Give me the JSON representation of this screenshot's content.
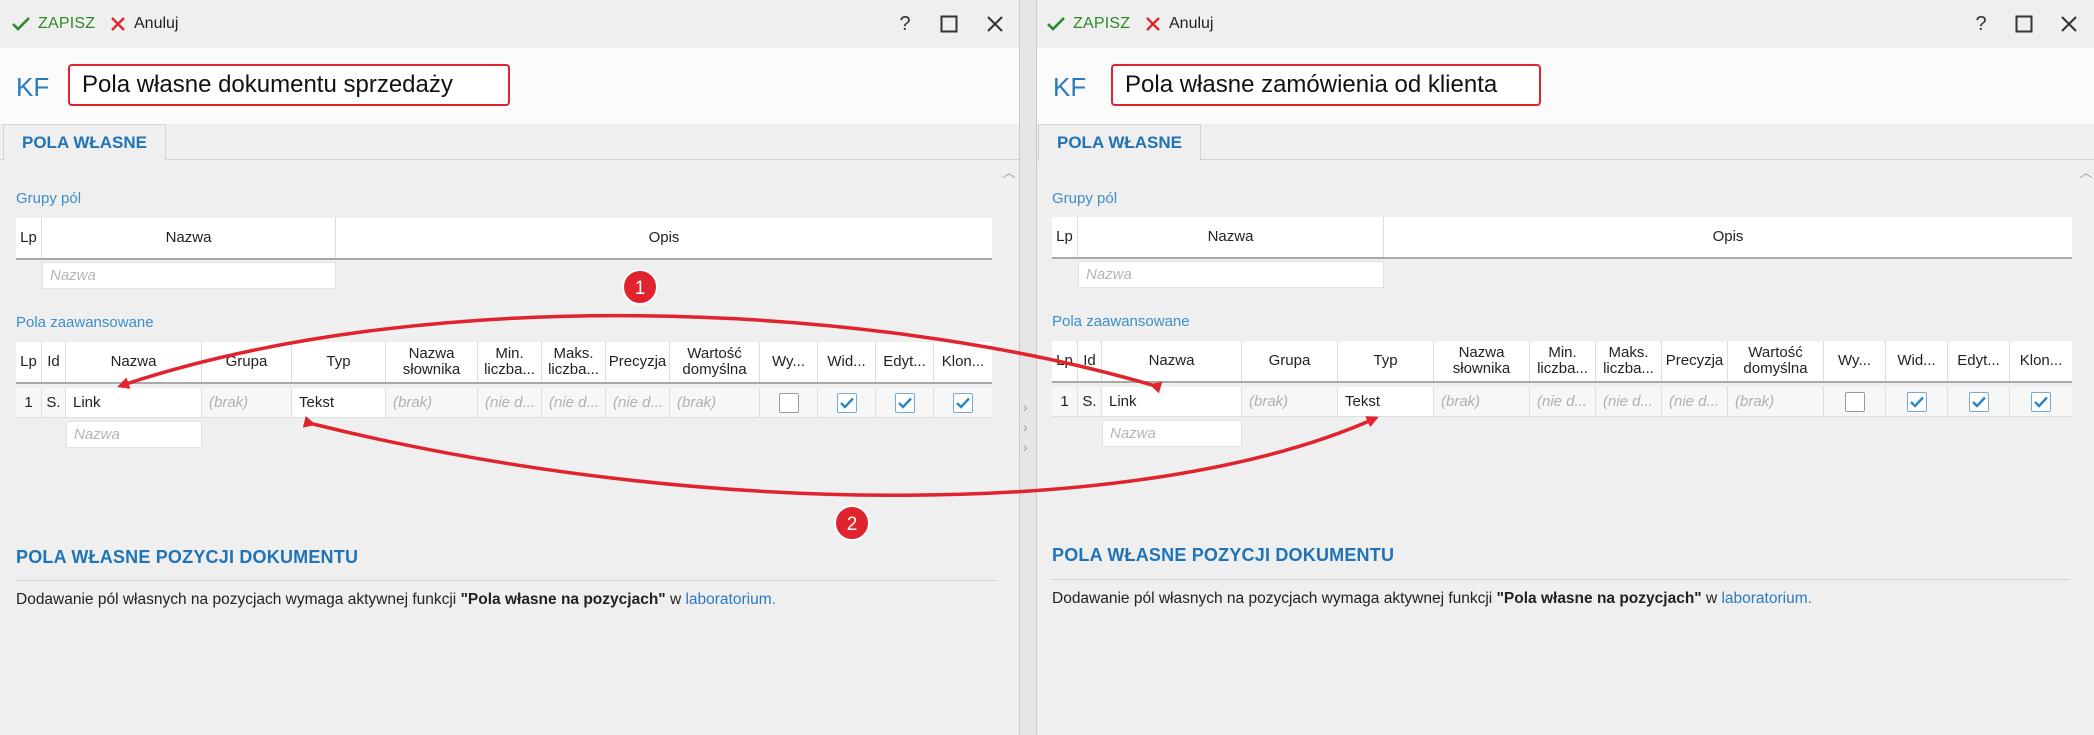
{
  "toolbar": {
    "save_label": "ZAPISZ",
    "cancel_label": "Anuluj",
    "help_label": "?"
  },
  "header": {
    "prefix": "KF"
  },
  "tab_label": "POLA WŁASNE",
  "groups": {
    "label": "Grupy pól",
    "columns": [
      "Lp",
      "Nazwa",
      "Opis"
    ],
    "new_placeholder": "Nazwa"
  },
  "advanced": {
    "label": "Pola zaawansowane",
    "columns": [
      "Lp",
      "Id",
      "Nazwa",
      "Grupa",
      "Typ",
      "Nazwa słownika",
      "Min. liczba...",
      "Maks. liczba...",
      "Precyzja",
      "Wartość domyślna",
      "Wy...",
      "Wid...",
      "Edyt...",
      "Klon..."
    ],
    "row": {
      "lp": "1",
      "id": "S.",
      "nazwa": "Link",
      "grupa": "(brak)",
      "typ": "Tekst",
      "slownik": "(brak)",
      "min": "(nie d...",
      "maks": "(nie d...",
      "precyzja": "(nie d...",
      "domyslna": "(brak)",
      "wy": false,
      "wid": true,
      "edyt": true,
      "klon": true
    },
    "new_placeholder": "Nazwa"
  },
  "positions": {
    "title": "POLA WŁASNE POZYCJI DOKUMENTU",
    "note_prefix": "Dodawanie pól własnych na pozycjach wymaga aktywnej funkcji ",
    "note_bold": "\"Pola własne na pozycjach\"",
    "note_mid": " w ",
    "note_link": "laboratorium."
  },
  "left": {
    "title": "Pola własne dokumentu sprzedaży"
  },
  "right": {
    "title": "Pola własne zamówienia od klienta"
  },
  "annotations": {
    "badge1": "1",
    "badge2": "2",
    "color": "#e0232d"
  },
  "colors": {
    "accent": "#1f73b7",
    "save": "#2b8a27",
    "cancel": "#d9282f",
    "highlight": "#e0232d",
    "check": "#2a86c8"
  }
}
